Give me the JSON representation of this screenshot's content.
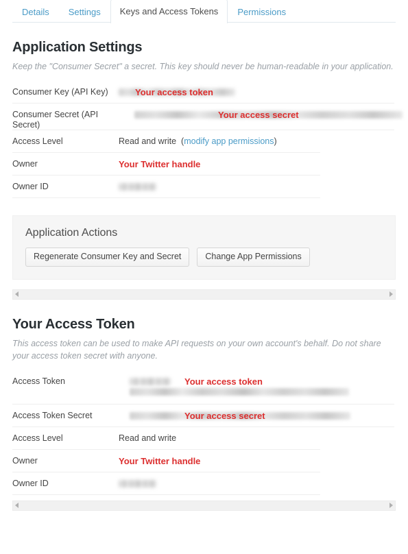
{
  "tabs": [
    {
      "label": "Details",
      "active": false
    },
    {
      "label": "Settings",
      "active": false
    },
    {
      "label": "Keys and Access Tokens",
      "active": true
    },
    {
      "label": "Permissions",
      "active": false
    }
  ],
  "app_settings": {
    "title": "Application Settings",
    "description": "Keep the \"Consumer Secret\" a secret. This key should never be human-readable in your application.",
    "rows": [
      {
        "label": "Consumer Key (API Key)",
        "value": "",
        "annotation": "Your access token",
        "redacted": true
      },
      {
        "label": "Consumer Secret (API Secret)",
        "value": "",
        "annotation": "Your access secret",
        "redacted": true
      },
      {
        "label": "Access Level",
        "value": "Read and write",
        "link": "modify app permissions",
        "redacted": false
      },
      {
        "label": "Owner",
        "value": "",
        "annotation": "Your Twitter handle",
        "redacted": false
      },
      {
        "label": "Owner ID",
        "value": "",
        "redacted": true
      }
    ]
  },
  "app_actions": {
    "title": "Application Actions",
    "buttons": [
      {
        "label": "Regenerate Consumer Key and Secret"
      },
      {
        "label": "Change App Permissions"
      }
    ]
  },
  "access_token": {
    "title": "Your Access Token",
    "description": "This access token can be used to make API requests on your own account's behalf. Do not share your access token secret with anyone.",
    "rows": [
      {
        "label": "Access Token",
        "value": "",
        "annotation": "Your access token",
        "redacted": true
      },
      {
        "label": "Access Token Secret",
        "value": "",
        "annotation": "Your access secret",
        "redacted": true
      },
      {
        "label": "Access Level",
        "value": "Read and write",
        "redacted": false
      },
      {
        "label": "Owner",
        "value": "",
        "annotation": "Your Twitter handle",
        "redacted": false
      },
      {
        "label": "Owner ID",
        "value": "",
        "redacted": true
      }
    ]
  },
  "scrollbars": {
    "left_arrow": "scroll-left",
    "right_arrow": "scroll-right"
  },
  "colors": {
    "link": "#4a9bc7",
    "annotation": "#dc2f2f",
    "heading": "#292f33",
    "panel_bg": "#f6f6f6"
  }
}
